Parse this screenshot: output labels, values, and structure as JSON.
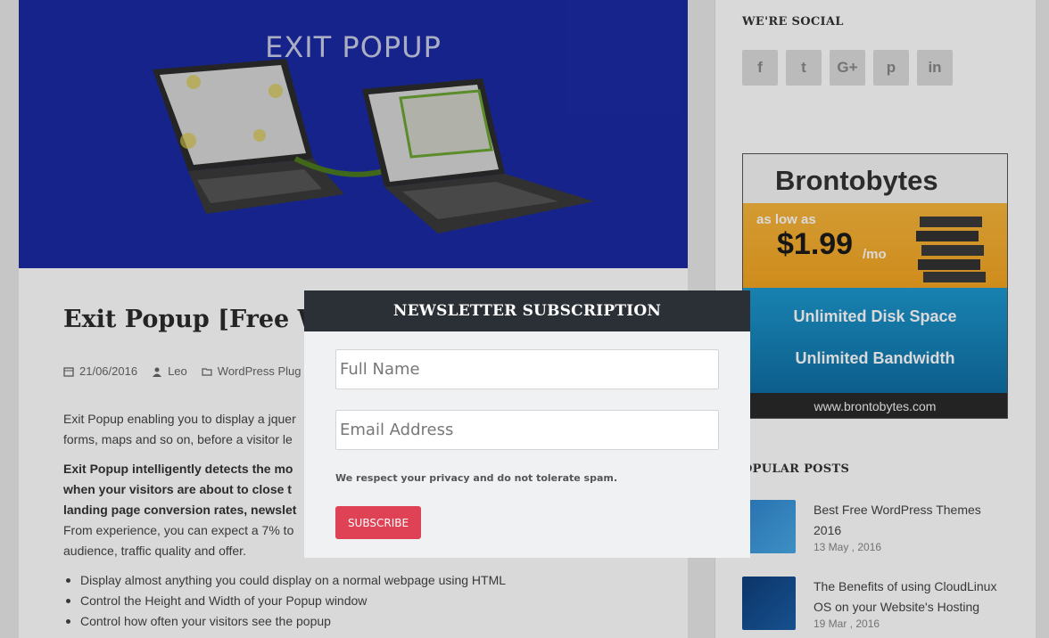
{
  "hero": {
    "title": "EXIT POPUP"
  },
  "post": {
    "title": "Exit Popup [Free Wo",
    "meta": {
      "date": "21/06/2016",
      "author": "Leo",
      "category": "WordPress Plug"
    },
    "intro_line1": "Exit Popup enabling you to display a jquer",
    "intro_line2": "forms, maps and so on, before a visitor le",
    "bold_line1": "Exit Popup intelligently detects the mo",
    "bold_line2": "when your visitors are about to close t",
    "bold_line3": "landing page conversion rates, newslet",
    "exp_line1": "From experience, you can expect a 7% to",
    "exp_line2": "audience, traffic quality and offer.",
    "bullets": [
      "Display almost anything you could display on a normal webpage using HTML",
      "Control the Height and Width of your Popup window",
      "Control how often your visitors see the popup"
    ]
  },
  "sidebar": {
    "social_heading": "WE'RE SOCIAL",
    "social": [
      {
        "icon": "facebook-icon",
        "glyph": "f"
      },
      {
        "icon": "twitter-icon",
        "glyph": "t"
      },
      {
        "icon": "google-plus-icon",
        "glyph": "G+"
      },
      {
        "icon": "pinterest-icon",
        "glyph": "p"
      },
      {
        "icon": "linkedin-icon",
        "glyph": "in"
      }
    ],
    "ad": {
      "brand": "Brontobytes",
      "as_low_as": "as low as",
      "price": "$1.99",
      "per": "/mo",
      "line1": "Unlimited Disk Space",
      "line2": "Unlimited Bandwidth",
      "url": "www.brontobytes.com"
    },
    "popular_heading": "OPULAR POSTS",
    "popular": [
      {
        "title": "Best Free WordPress Themes 2016",
        "date": "13 May , 2016"
      },
      {
        "title": "The Benefits of using CloudLinux OS on your Website's Hosting",
        "date": "19 Mar , 2016"
      }
    ]
  },
  "modal": {
    "title": "NEWSLETTER SUBSCRIPTION",
    "name_placeholder": "Full Name",
    "email_placeholder": "Email Address",
    "privacy": "We respect your privacy and do not tolerate spam.",
    "button": "SUBSCRIBE"
  },
  "colors": {
    "modal_header": "#2b2f36",
    "subscribe": "#e04255",
    "hero_bg": "#1a2aa4"
  }
}
